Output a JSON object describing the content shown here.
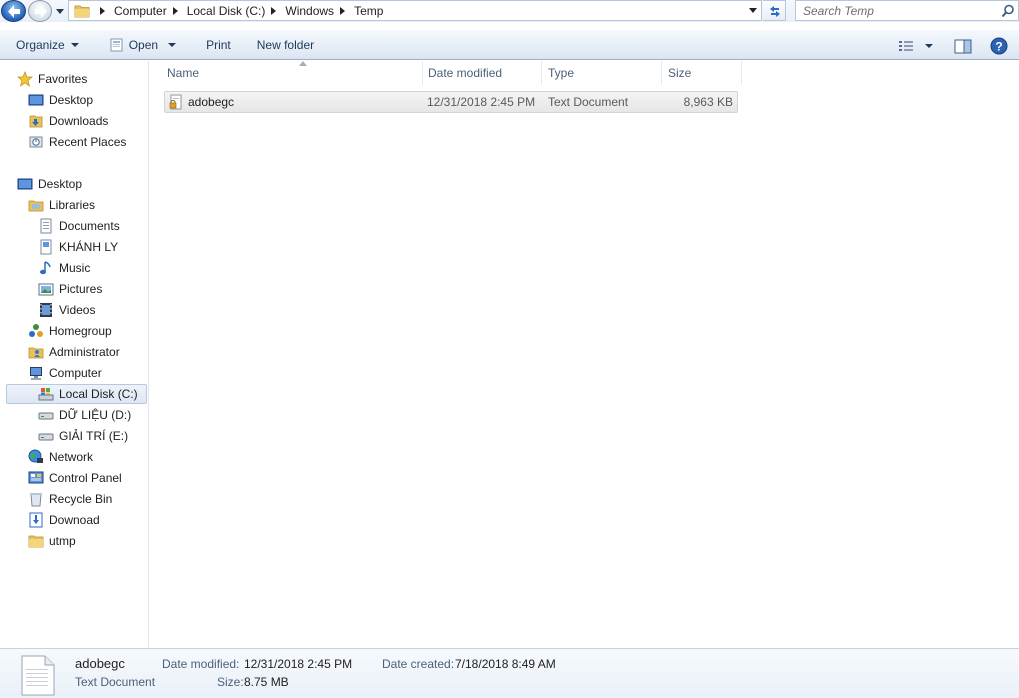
{
  "address": {
    "crumbs": [
      "Computer",
      "Local Disk (C:)",
      "Windows",
      "Temp"
    ]
  },
  "search": {
    "placeholder": "Search Temp"
  },
  "toolbar": {
    "organize": "Organize",
    "open": "Open",
    "print": "Print",
    "new_folder": "New folder"
  },
  "nav": {
    "favorites": "Favorites",
    "desktop_fav": "Desktop",
    "downloads": "Downloads",
    "recent": "Recent Places",
    "desktop": "Desktop",
    "libraries": "Libraries",
    "documents": "Documents",
    "khanh_ly": "KHÁNH LY",
    "music": "Music",
    "pictures": "Pictures",
    "videos": "Videos",
    "homegroup": "Homegroup",
    "administrator": "Administrator",
    "computer": "Computer",
    "local_disk": "Local Disk (C:)",
    "du_lieu": "DỮ LIỆU (D:)",
    "giai_tri": "GIẢI TRÍ (E:)",
    "network": "Network",
    "control_panel": "Control Panel",
    "recycle_bin": "Recycle Bin",
    "download": "Downoad",
    "utmp": "utmp"
  },
  "columns": {
    "name": "Name",
    "date": "Date modified",
    "type": "Type",
    "size": "Size"
  },
  "files": [
    {
      "name": "adobegc",
      "date": "12/31/2018 2:45 PM",
      "type": "Text Document",
      "size": "8,963 KB"
    }
  ],
  "details": {
    "name": "adobegc",
    "type": "Text Document",
    "date_modified_label": "Date modified:",
    "date_modified": "12/31/2018 2:45 PM",
    "size_label": "Size:",
    "size": "8.75 MB",
    "date_created_label": "Date created:",
    "date_created": "7/18/2018 8:49 AM"
  }
}
